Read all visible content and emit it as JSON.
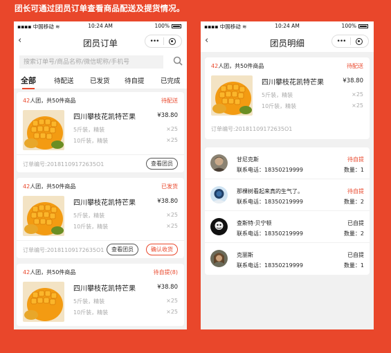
{
  "caption": "团长可通过团员订单查看商品配送及提货情况。",
  "status_bar": {
    "carrier": "中国移动",
    "time": "10:24 AM",
    "battery": "100%"
  },
  "left": {
    "title": "团员订单",
    "search_placeholder": "搜索订单号/商品名称/微信昵称/手机号",
    "tabs": [
      "全部",
      "待配送",
      "已发货",
      "待自提",
      "已完成"
    ],
    "orders": [
      {
        "count": "42",
        "count_text": "人团，共50件商品",
        "status": "待配送",
        "product": "四川攀枝花凯特芒果",
        "price": "¥38.80",
        "specs": [
          {
            "label": "5斤装，精装",
            "qty": "×25"
          },
          {
            "label": "10斤装，精装",
            "qty": "×25"
          }
        ],
        "order_no": "订单编号:20181109172635O1",
        "buttons": [
          "查看团员"
        ]
      },
      {
        "count": "42",
        "count_text": "人团，共50件商品",
        "status": "已发货",
        "product": "四川攀枝花凯特芒果",
        "price": "¥38.80",
        "specs": [
          {
            "label": "5斤装，精装",
            "qty": "×25"
          },
          {
            "label": "10斤装，精装",
            "qty": "×25"
          }
        ],
        "order_no": "订单编号:20181109172635O1",
        "buttons": [
          "查看团员",
          "确认收货"
        ]
      },
      {
        "count": "42",
        "count_text": "人团，共50件商品",
        "status": "待自提(8)",
        "product": "四川攀枝花凯特芒果",
        "price": "¥38.80",
        "specs": [
          {
            "label": "5斤装，精装",
            "qty": "×25"
          },
          {
            "label": "10斤装，精装",
            "qty": "×25"
          }
        ]
      }
    ]
  },
  "right": {
    "title": "团员明细",
    "order": {
      "count": "42",
      "count_text": "人团，共50件商品",
      "status": "待配送",
      "product": "四川攀枝花凯特芒果",
      "price": "¥38.80",
      "specs": [
        {
          "label": "5斤装，精装",
          "qty": "×25"
        },
        {
          "label": "10斤装，精装",
          "qty": "×25"
        }
      ],
      "order_no": "订单编号:20181109172635O1"
    },
    "members": [
      {
        "name": "甘尼克斯",
        "phone": "联系电话：18350219999",
        "status": "待自提",
        "qty": "数量：1",
        "done": false
      },
      {
        "name": "那棵树看起来真的生气了。",
        "phone": "联系电话：18350219999",
        "status": "待自提",
        "qty": "数量：2",
        "done": false
      },
      {
        "name": "查斯特·贝宁顿",
        "phone": "联系电话：18350219999",
        "status": "已自提",
        "qty": "数量：2",
        "done": true
      },
      {
        "name": "克丽斯",
        "phone": "联系电话：18350219999",
        "status": "已自提",
        "qty": "数量：1",
        "done": true
      }
    ]
  },
  "colors": {
    "accent": "#e9472b",
    "background": "#e9472b"
  }
}
